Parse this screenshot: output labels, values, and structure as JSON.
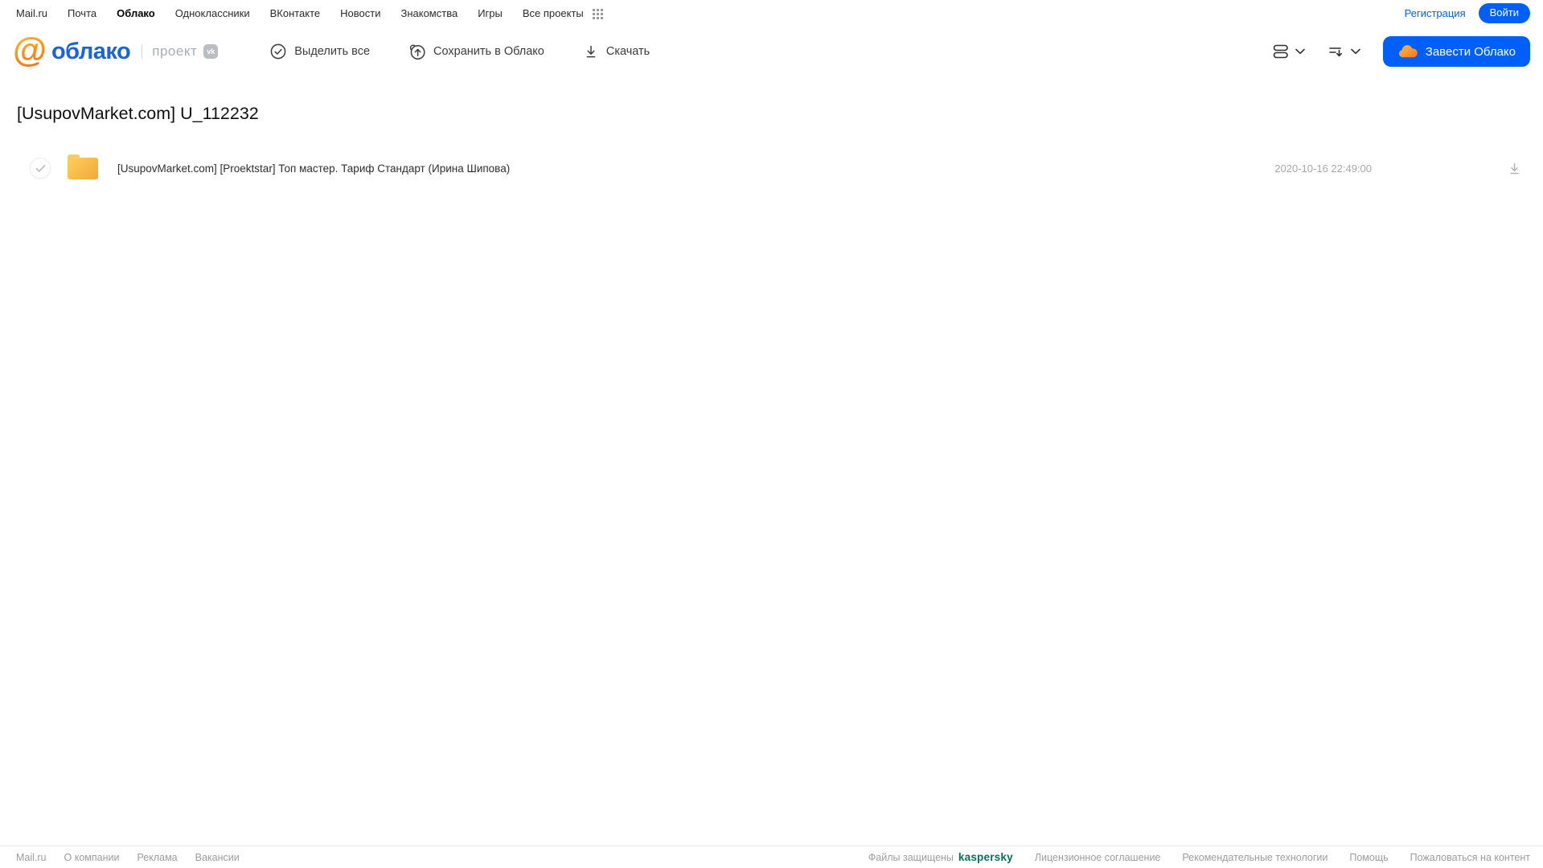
{
  "topnav": {
    "items": [
      "Mail.ru",
      "Почта",
      "Облако",
      "Одноклассники",
      "ВКонтакте",
      "Новости",
      "Знакомства",
      "Игры",
      "Все проекты"
    ],
    "register_label": "Регистрация",
    "login_label": "Войти"
  },
  "header": {
    "logo_at": "@",
    "logo_text": "облако",
    "project_label": "проект",
    "vk_badge": "vk",
    "toolbar": {
      "select_all": "Выделить все",
      "save_to_cloud": "Сохранить в Облако",
      "download": "Скачать"
    },
    "get_cloud_button": "Завести Облако"
  },
  "main": {
    "title": "[UsupovMarket.com] U_112232",
    "files": [
      {
        "type": "folder",
        "name": "[UsupovMarket.com] [Proektstar] Топ мастер. Тариф Стандарт (Ирина Шипова)",
        "date": "2020-10-16 22:49:00"
      }
    ]
  },
  "footer": {
    "left_links": [
      "Mail.ru",
      "О компании",
      "Реклама",
      "Вакансии"
    ],
    "protected_label": "Файлы защищены",
    "kaspersky_label": "kaspersky",
    "right_links": [
      "Лицензионное соглашение",
      "Рекомендательные технологии",
      "Помощь",
      "Пожаловаться на контент"
    ]
  },
  "colors": {
    "accent_blue": "#005ff9",
    "logo_blue": "#1c63d9",
    "logo_orange": "#f98a16",
    "folder_yellow": "#f9c64f",
    "kaspersky_teal": "#00715c",
    "muted_gray": "#9c9c9c"
  },
  "icons": {
    "grid": "apps-grid-9-dots",
    "check_circle": "circled-checkmark",
    "cloud_upload": "cloud-with-up-arrow",
    "download": "arrow-down-to-line",
    "list_view": "two-stacked-rows",
    "sort": "lines-with-down-arrow",
    "chevron": "chevron-down",
    "cloud": "orange-cloud-blob",
    "checkbox_check": "gray-checkmark"
  }
}
